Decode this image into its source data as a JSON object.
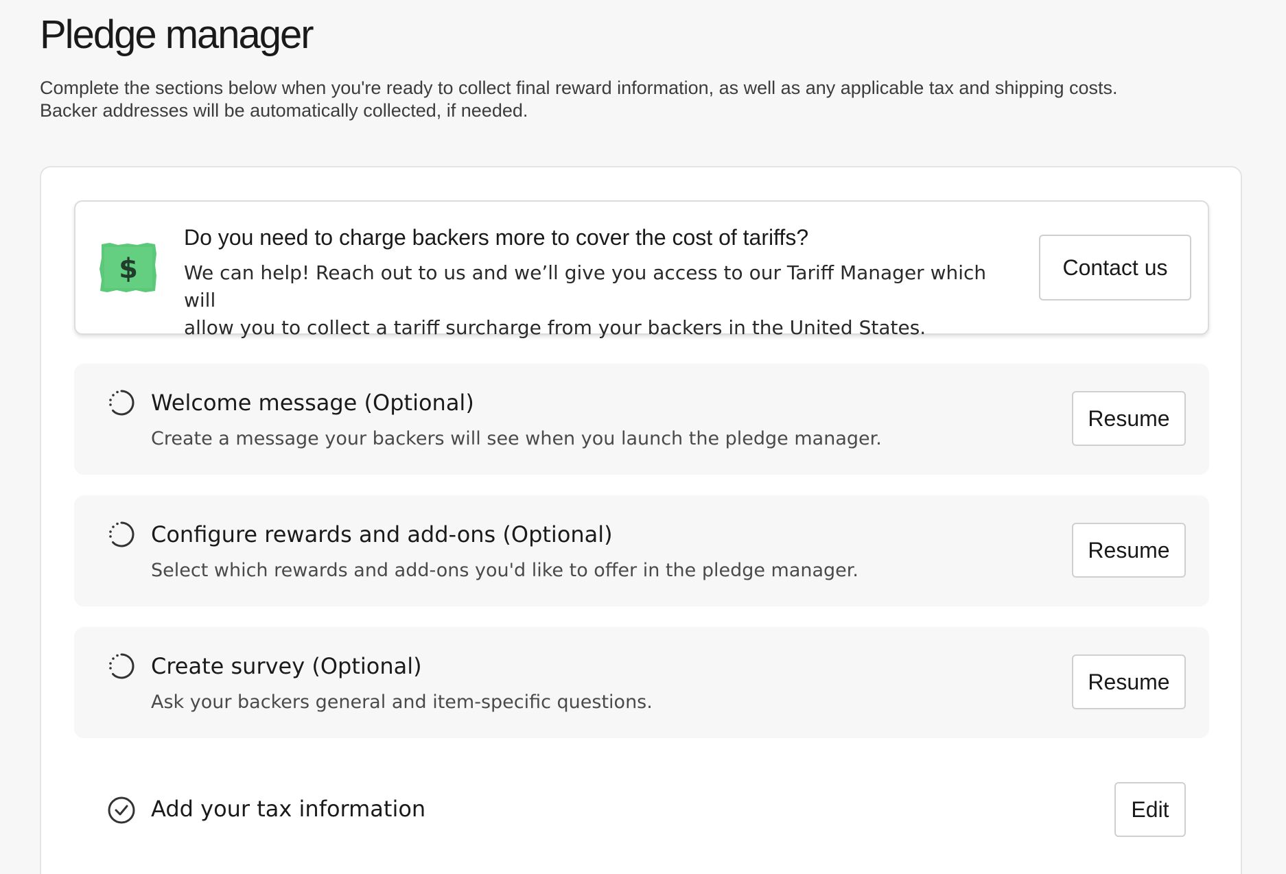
{
  "header": {
    "title": "Pledge manager",
    "description_line1": "Complete the sections below when you're ready to collect final reward information, as well as any applicable tax and shipping costs.",
    "description_line2": "Backer addresses will be automatically collected, if needed."
  },
  "tariff_banner": {
    "icon": "dollar-bill-icon",
    "icon_color": "#5cc97a",
    "title": "Do you need to charge backers more to cover the cost of tariffs?",
    "body_line1": "We can help! Reach out to us and we’ll give you access to our Tariff Manager which will",
    "body_line2": "allow you to collect a tariff surcharge from your backers in the United States.",
    "button_label": "Contact us"
  },
  "steps": [
    {
      "icon": "incomplete-circle-icon",
      "title": "Welcome message (Optional)",
      "description": "Create a message your backers will see when you launch the pledge manager.",
      "button_label": "Resume"
    },
    {
      "icon": "incomplete-circle-icon",
      "title": "Configure rewards and add-ons (Optional)",
      "description": "Select which rewards and add-ons you'd like to offer in the pledge manager.",
      "button_label": "Resume"
    },
    {
      "icon": "incomplete-circle-icon",
      "title": "Create survey (Optional)",
      "description": "Ask your backers general and item-specific questions.",
      "button_label": "Resume"
    }
  ],
  "tax_step": {
    "icon": "check-circle-icon",
    "title": "Add your tax information",
    "button_label": "Edit"
  }
}
